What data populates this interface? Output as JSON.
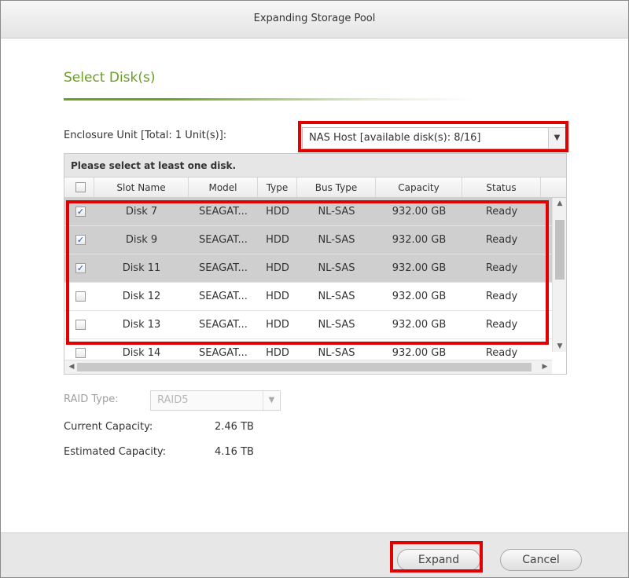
{
  "window": {
    "title": "Expanding Storage Pool"
  },
  "section": {
    "title": "Select Disk(s)"
  },
  "enclosure": {
    "label": "Enclosure Unit [Total: 1 Unit(s)]:",
    "selected": "NAS Host [available disk(s): 8/16]"
  },
  "grid": {
    "banner": "Please select at least one disk.",
    "columns": [
      "Slot Name",
      "Model",
      "Type",
      "Bus Type",
      "Capacity",
      "Status"
    ],
    "rows": [
      {
        "checked": true,
        "slot": "Disk 7",
        "model": "SEAGAT...",
        "type": "HDD",
        "bus": "NL-SAS",
        "capacity": "932.00 GB",
        "status": "Ready"
      },
      {
        "checked": true,
        "slot": "Disk 9",
        "model": "SEAGAT...",
        "type": "HDD",
        "bus": "NL-SAS",
        "capacity": "932.00 GB",
        "status": "Ready"
      },
      {
        "checked": true,
        "slot": "Disk 11",
        "model": "SEAGAT...",
        "type": "HDD",
        "bus": "NL-SAS",
        "capacity": "932.00 GB",
        "status": "Ready"
      },
      {
        "checked": false,
        "slot": "Disk 12",
        "model": "SEAGAT...",
        "type": "HDD",
        "bus": "NL-SAS",
        "capacity": "932.00 GB",
        "status": "Ready"
      },
      {
        "checked": false,
        "slot": "Disk 13",
        "model": "SEAGAT...",
        "type": "HDD",
        "bus": "NL-SAS",
        "capacity": "932.00 GB",
        "status": "Ready"
      },
      {
        "checked": false,
        "slot": "Disk 14",
        "model": "SEAGAT...",
        "type": "HDD",
        "bus": "NL-SAS",
        "capacity": "932.00 GB",
        "status": "Ready"
      }
    ]
  },
  "raid": {
    "label": "RAID Type:",
    "value": "RAID5"
  },
  "current_capacity": {
    "label": "Current Capacity:",
    "value": "2.46 TB"
  },
  "estimated_capacity": {
    "label": "Estimated Capacity:",
    "value": "4.16 TB"
  },
  "footer": {
    "expand_label": "Expand",
    "cancel_label": "Cancel"
  },
  "colors": {
    "accent_green": "#6aa01f",
    "highlight_red": "#e00000",
    "selected_row": "#cfcfcf"
  }
}
